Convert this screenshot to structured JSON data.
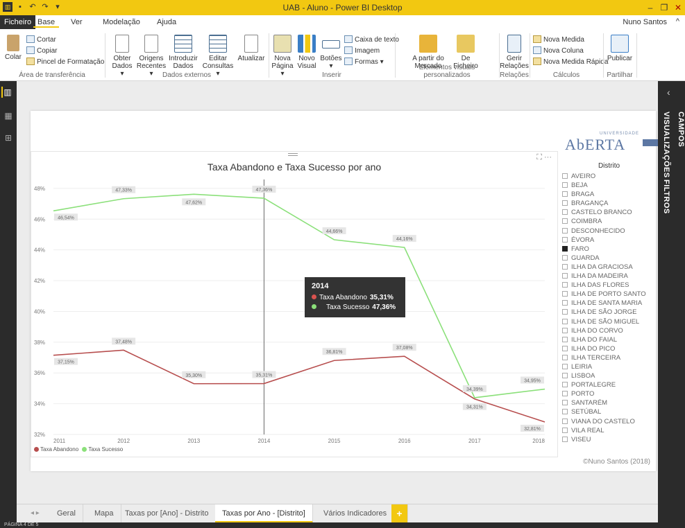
{
  "window": {
    "title": "UAB - Aluno - Power BI Desktop",
    "user": "Nuno Santos"
  },
  "menu": {
    "tabs": [
      "Ficheiro",
      "Base",
      "Ver",
      "Modelação",
      "Ajuda"
    ]
  },
  "ribbon": {
    "clipboard": {
      "paste": "Colar",
      "cut": "Cortar",
      "copy": "Copiar",
      "format_painter": "Pincel de Formatação",
      "group": "Área de transferência"
    },
    "external": {
      "get_data": "Obter Dados ▾",
      "recent": "Origens Recentes ▾",
      "enter_data": "Introduzir Dados",
      "edit_queries": "Editar Consultas ▾",
      "refresh": "Atualizar",
      "group": "Dados externos"
    },
    "insert": {
      "new_page": "Nova Página ▾",
      "new_visual": "Novo Visual",
      "buttons": "Botões ▾",
      "text_box": "Caixa de texto",
      "image": "Imagem",
      "shapes": "Formas ▾",
      "group": "Inserir"
    },
    "custom": {
      "marketplace": "A partir do Mercado",
      "file": "De Ficheiro",
      "group": "Elementos visuais personalizados"
    },
    "relations": {
      "manage": "Gerir Relações",
      "group": "Relações"
    },
    "calc": {
      "new_measure": "Nova Medida",
      "new_column": "Nova Coluna",
      "quick_measure": "Nova Medida Rápida",
      "group": "Cálculos"
    },
    "share": {
      "publish": "Publicar",
      "group": "Partilhar"
    }
  },
  "right_panel": {
    "visualizations": "VISUALIZAÇÕES",
    "filters": "FILTROS",
    "fields": "CAMPOS"
  },
  "logo": {
    "small": "UNIVERSIDADE",
    "big": "AbERTA"
  },
  "chart_data": {
    "type": "line",
    "title": "Taxa Abandono e Taxa Sucesso por ano",
    "categories": [
      "2011",
      "2012",
      "2013",
      "2014",
      "2015",
      "2016",
      "2017",
      "2018"
    ],
    "series": [
      {
        "name": "Taxa Abandono",
        "color": "#b74e4e",
        "values": [
          37.15,
          37.48,
          35.3,
          35.31,
          36.81,
          37.08,
          34.31,
          32.81
        ],
        "labels": [
          "37,15%",
          "37,48%",
          "35,30%",
          "35,31%",
          "36,81%",
          "37,08%",
          "34,31%",
          "32,81%"
        ]
      },
      {
        "name": "Taxa Sucesso",
        "color": "#8be07a",
        "values": [
          46.54,
          47.33,
          47.62,
          47.36,
          44.66,
          44.16,
          34.39,
          34.95
        ],
        "labels": [
          "46,54%",
          "47,33%",
          "47,62%",
          "47,36%",
          "44,66%",
          "44,16%",
          "34,39%",
          "34,95%"
        ]
      }
    ],
    "yticks": [
      "32%",
      "34%",
      "36%",
      "38%",
      "40%",
      "42%",
      "44%",
      "46%",
      "48%"
    ],
    "ylim": [
      32,
      48.4
    ],
    "grid": true,
    "legend": "bottom-left"
  },
  "tooltip": {
    "year": "2014",
    "rows": [
      {
        "name": "Taxa Abandono",
        "value": "35,31%",
        "color": "#d9534f"
      },
      {
        "name": "Taxa Sucesso",
        "value": "47,36%",
        "color": "#8be07a"
      }
    ]
  },
  "slicer": {
    "title": "Distrito",
    "items": [
      "AVEIRO",
      "BEJA",
      "BRAGA",
      "BRAGANÇA",
      "CASTELO BRANCO",
      "COIMBRA",
      "DESCONHECIDO",
      "ÉVORA",
      "FARO",
      "GUARDA",
      "ILHA DA GRACIOSA",
      "ILHA DA MADEIRA",
      "ILHA DAS FLORES",
      "ILHA DE PORTO SANTO",
      "ILHA DE SANTA MARIA",
      "ILHA DE SÃO JORGE",
      "ILHA DE SÃO MIGUEL",
      "ILHA DO CORVO",
      "ILHA DO FAIAL",
      "ILHA DO PICO",
      "ILHA TERCEIRA",
      "LEIRIA",
      "LISBOA",
      "PORTALEGRE",
      "PORTO",
      "SANTARÉM",
      "SETÚBAL",
      "VIANA DO CASTELO",
      "VILA REAL",
      "VISEU"
    ],
    "selected": "FARO"
  },
  "credit": "©Nuno Santos (2018)",
  "pages": [
    "Geral",
    "Mapa",
    "Taxas por [Ano] - Distrito",
    "Taxas por Ano - [Distrito]",
    "Vários Indicadores"
  ],
  "active_page": 3,
  "add_page": "+",
  "status": "PÁGINA 4 DE 5"
}
